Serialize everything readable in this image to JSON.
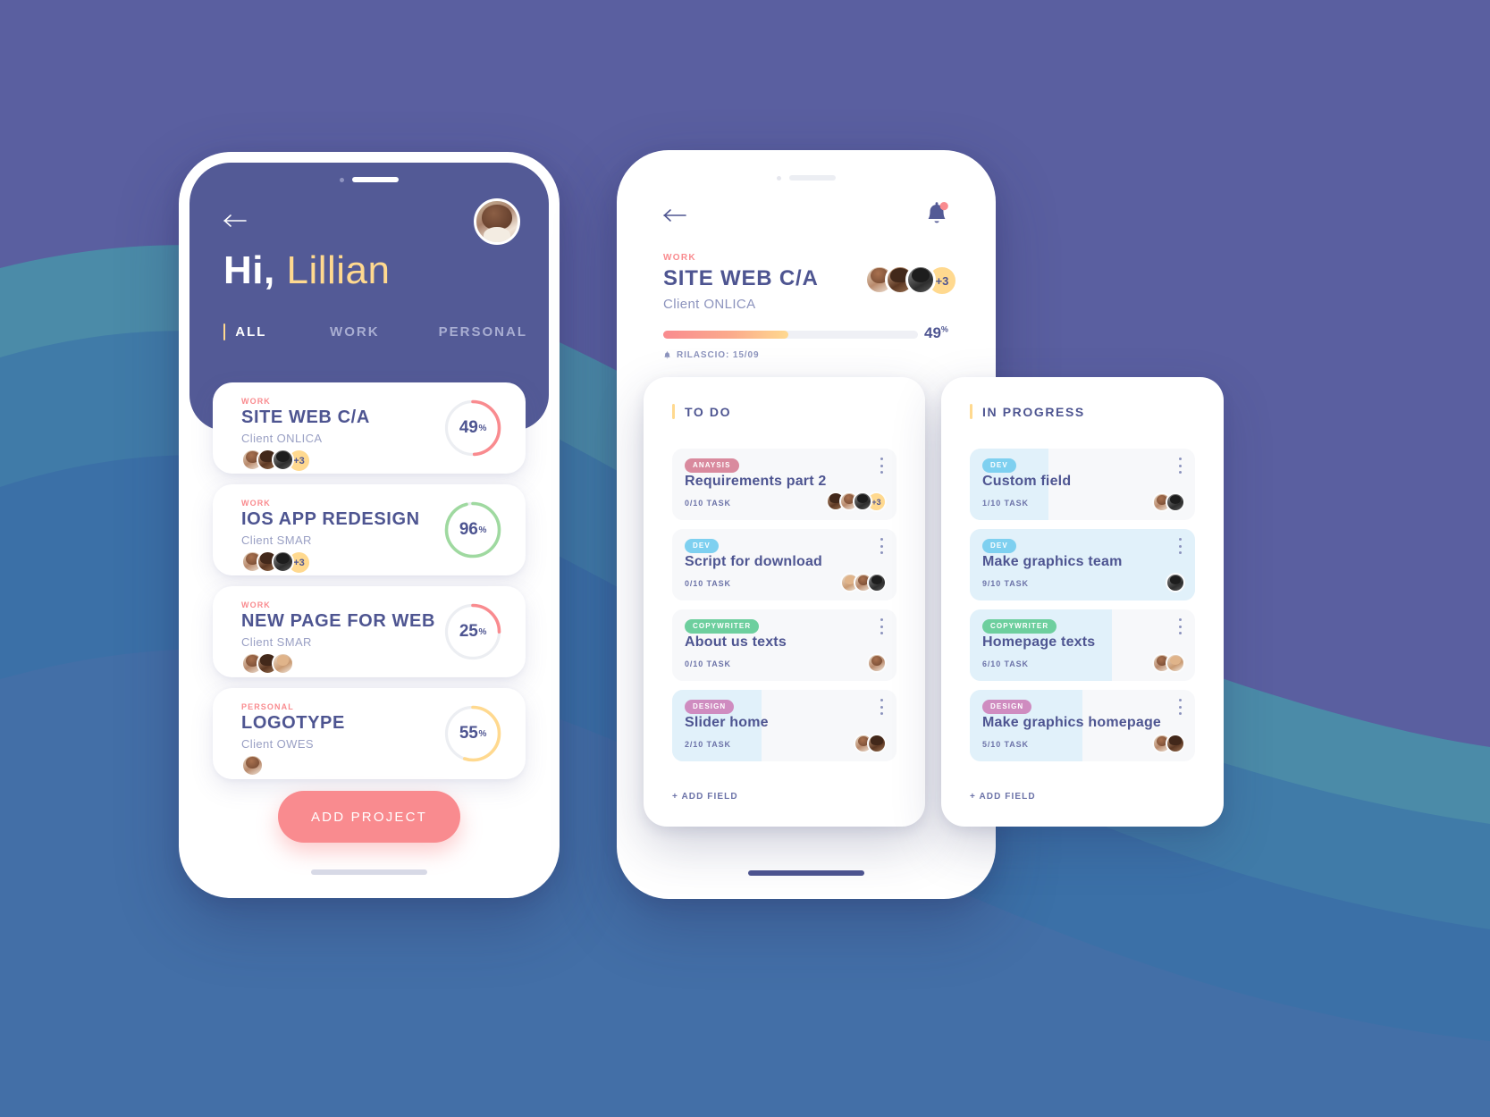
{
  "colors": {
    "bg_purple": "#5a5fa0",
    "blob_teal": "#4a8fa8",
    "blob_blue": "#3f73a8",
    "accent_pink": "#f98b8f",
    "accent_yellow": "#ffd98f",
    "accent_green": "#9fd9a0",
    "text_indigo": "#4e5591",
    "header_indigo": "#535a96",
    "card_blue_fill": "#e1f1fa"
  },
  "phone1": {
    "status_notch": "notch-pill",
    "back_icon": "arrow-left-icon",
    "avatar": "user-avatar",
    "greeting_hi": "Hi,",
    "greeting_name": "Lillian",
    "tabs": [
      {
        "label": "ALL",
        "active": true
      },
      {
        "label": "WORK",
        "active": false
      },
      {
        "label": "PERSONAL",
        "active": false
      }
    ],
    "projects": [
      {
        "tag": "WORK",
        "title": "SITE WEB C/A",
        "client": "Client ONLICA",
        "percent": 49,
        "percent_label": "49",
        "percent_symbol": "%",
        "ring_color": "#f98b8f",
        "avatars": [
          "av-a",
          "av-b",
          "av-c"
        ],
        "more": "+3"
      },
      {
        "tag": "WORK",
        "title": "IOS APP REDESIGN",
        "client": "Client SMAR",
        "percent": 96,
        "percent_label": "96",
        "percent_symbol": "%",
        "ring_color": "#9fd9a0",
        "avatars": [
          "av-a",
          "av-b",
          "av-c"
        ],
        "more": "+3"
      },
      {
        "tag": "WORK",
        "title": "NEW PAGE FOR WEB",
        "client": "Client SMAR",
        "percent": 25,
        "percent_label": "25",
        "percent_symbol": "%",
        "ring_color": "#f98b8f",
        "avatars": [
          "av-a",
          "av-b",
          "av-d"
        ],
        "more": ""
      },
      {
        "tag": "PERSONAL",
        "title": "LOGOTYPE",
        "client": "Client OWES",
        "percent": 55,
        "percent_label": "55",
        "percent_symbol": "%",
        "ring_color": "#ffd98f",
        "avatars": [
          "av-a"
        ],
        "more": ""
      }
    ],
    "add_project_label": "ADD PROJECT"
  },
  "phone2": {
    "back_icon": "arrow-left-icon",
    "bell_icon": "bell-notification-icon",
    "tag": "WORK",
    "title": "SITE WEB C/A",
    "client": "Client ONLICA",
    "avatars": [
      "av-a",
      "av-b",
      "av-c"
    ],
    "avatars_more": "+3",
    "progress_percent": 49,
    "progress_label": "49",
    "progress_symbol": "%",
    "release_icon": "bell-small-icon",
    "release_label": "RILASCIO: 15/09"
  },
  "columns": [
    {
      "title": "TO DO",
      "add_label": "+ ADD FIELD",
      "cards": [
        {
          "badge": "ANAYSIS",
          "badge_color": "#d98a9e",
          "title": "Requirements part 2",
          "meta": "0/10 TASK",
          "fill_percent": 0,
          "avatars": [
            "av-b",
            "av-a",
            "av-c"
          ],
          "more": "+3",
          "menu_icon": "more-vertical-icon"
        },
        {
          "badge": "DEV",
          "badge_color": "#7ed0f0",
          "title": "Script for download",
          "meta": "0/10 TASK",
          "fill_percent": 0,
          "avatars": [
            "av-d",
            "av-a",
            "av-c"
          ],
          "more": "",
          "menu_icon": "more-vertical-icon"
        },
        {
          "badge": "COPYWRITER",
          "badge_color": "#6dcf9e",
          "title": "About us texts",
          "meta": "0/10 TASK",
          "fill_percent": 0,
          "avatars": [
            "av-a"
          ],
          "more": "",
          "menu_icon": "more-vertical-icon"
        },
        {
          "badge": "DESIGN",
          "badge_color": "#cf8cc0",
          "title": "Slider home",
          "meta": "2/10 TASK",
          "fill_percent": 40,
          "avatars": [
            "av-a",
            "av-b"
          ],
          "more": "",
          "menu_icon": "more-vertical-icon"
        }
      ]
    },
    {
      "title": "IN PROGRESS",
      "add_label": "+ ADD FIELD",
      "cards": [
        {
          "badge": "DEV",
          "badge_color": "#7ed0f0",
          "title": "Custom field",
          "meta": "1/10 TASK",
          "fill_percent": 35,
          "avatars": [
            "av-a",
            "av-c"
          ],
          "more": "",
          "menu_icon": "more-vertical-icon"
        },
        {
          "badge": "DEV",
          "badge_color": "#7ed0f0",
          "title": "Make graphics team",
          "meta": "9/10 TASK",
          "fill_percent": 100,
          "avatars": [
            "av-c"
          ],
          "more": "",
          "menu_icon": "more-vertical-icon"
        },
        {
          "badge": "COPYWRITER",
          "badge_color": "#6dcf9e",
          "title": "Homepage texts",
          "meta": "6/10 TASK",
          "fill_percent": 63,
          "avatars": [
            "av-a",
            "av-d"
          ],
          "more": "",
          "menu_icon": "more-vertical-icon"
        },
        {
          "badge": "DESIGN",
          "badge_color": "#cf8cc0",
          "title": "Make graphics homepage",
          "meta": "5/10 TASK",
          "fill_percent": 50,
          "avatars": [
            "av-a",
            "av-b"
          ],
          "more": "",
          "menu_icon": "more-vertical-icon"
        }
      ]
    }
  ]
}
